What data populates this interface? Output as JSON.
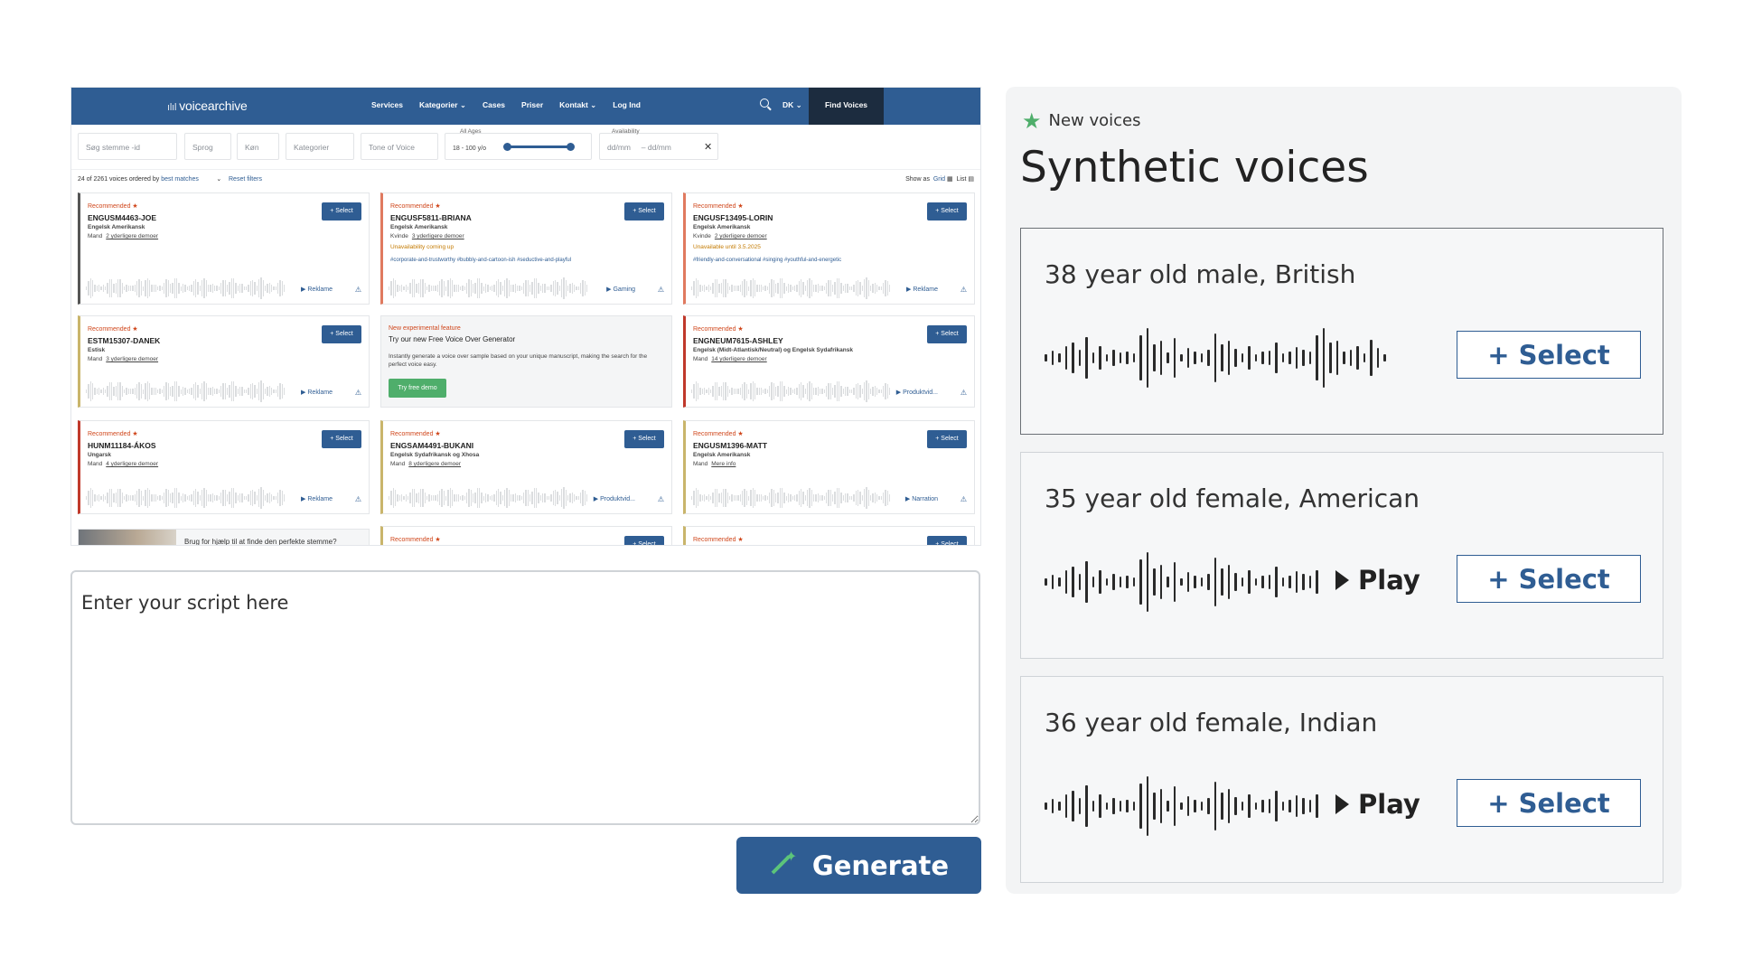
{
  "screenshot": {
    "logo": "voicearchive",
    "nav": [
      "Services",
      "Kategorier ⌄",
      "Cases",
      "Priser",
      "Kontakt ⌄",
      "Log Ind"
    ],
    "lang": "DK ⌄",
    "find_voices": "Find Voices",
    "filters": {
      "search_placeholder": "Søg stemme -id",
      "sprog": "Sprog",
      "kon": "Køn",
      "kategorier": "Kategorier",
      "tone": "Tone of Voice",
      "ages_label": "All Ages",
      "ages_range": "18 - 100 y/o",
      "availability_label": "Availability",
      "date_from": "dd/mm",
      "date_to": "– dd/mm",
      "clear": "✕"
    },
    "results": {
      "count": "24 of 2261 voices ordered by",
      "order": "best matches",
      "reset": "Reset filters",
      "show_as": "Show as",
      "grid": "Grid",
      "list": "List"
    },
    "cards": [
      {
        "rec": "Recommended",
        "id": "ENGUSM4463-JOE",
        "lang": "Engelsk Amerikansk",
        "gender": "Mand",
        "more": "2 yderligere demoer",
        "avail": "",
        "tags": "",
        "cat": "Reklame",
        "select": "+ Select"
      },
      {
        "rec": "Recommended",
        "id": "ENGUSF5811-BRIANA",
        "lang": "Engelsk Amerikansk",
        "gender": "Kvinde",
        "more": "3 yderligere demoer",
        "avail": "Unavailability coming up",
        "tags": "#corporate-and-trustworthy #bubbly-and-cartoon-ish #seductive-and-playful",
        "cat": "Gaming",
        "select": "+ Select"
      },
      {
        "rec": "Recommended",
        "id": "ENGUSF13495-LORIN",
        "lang": "Engelsk Amerikansk",
        "gender": "Kvinde",
        "more": "2 yderligere demoer",
        "avail": "Unavailable until 3.5.2025",
        "tags": "#friendly-and-conversational #singing #youthful-and-energetic",
        "cat": "Reklame",
        "select": "+ Select"
      },
      {
        "rec": "Recommended",
        "id": "ESTM15307-DANEK",
        "lang": "Estisk",
        "gender": "Mand",
        "more": "3 yderligere demoer",
        "avail": "",
        "tags": "",
        "cat": "Reklame",
        "select": "+ Select"
      },
      {
        "rec": "Recommended",
        "id": "ENGNEUM7615-ASHLEY",
        "lang": "Engelsk (Midt-Atlantisk/Neutral) og Engelsk Sydafrikansk",
        "gender": "Mand",
        "more": "14 yderligere demoer",
        "avail": "",
        "tags": "",
        "cat": "Produktvid...",
        "select": "+ Select"
      },
      {
        "rec": "Recommended",
        "id": "HUNM11184-ÁKOS",
        "lang": "Ungarsk",
        "gender": "Mand",
        "more": "4 yderligere demoer",
        "avail": "",
        "tags": "",
        "cat": "Reklame",
        "select": "+ Select"
      },
      {
        "rec": "Recommended",
        "id": "ENGSAM4491-BUKANI",
        "lang": "Engelsk Sydafrikansk og Xhosa",
        "gender": "Mand",
        "more": "8 yderligere demoer",
        "avail": "",
        "tags": "",
        "cat": "Produktvid...",
        "select": "+ Select"
      },
      {
        "rec": "Recommended",
        "id": "ENGUSM1396-MATT",
        "lang": "Engelsk Amerikansk",
        "gender": "Mand",
        "more": "Mere info",
        "avail": "",
        "tags": "",
        "cat": "Narration",
        "select": "+ Select"
      },
      {
        "rec": "Recommended",
        "id": "",
        "lang": "",
        "gender": "",
        "more": "",
        "avail": "",
        "tags": "",
        "cat": "",
        "select": "+ Select"
      },
      {
        "rec": "Recommended",
        "id": "",
        "lang": "",
        "gender": "",
        "more": "",
        "avail": "",
        "tags": "",
        "cat": "",
        "select": "+ Select"
      }
    ],
    "promo": {
      "label": "New experimental feature",
      "title": "Try our new Free Voice Over Generator",
      "body": "Instantly generate a voice over sample based on your unique manuscript, making the search for the perfect voice easy.",
      "button": "Try free demo"
    },
    "help": "Brug for hjælp til at finde den perfekte stemme?"
  },
  "script": {
    "placeholder": "Enter your script here"
  },
  "generate": {
    "label": "Generate",
    "icon": "magic-wand-icon"
  },
  "panel": {
    "badge": "New voices",
    "title": "Synthetic voices",
    "voices": [
      {
        "label": "38 year old male, British",
        "play": "",
        "select": "+ Select"
      },
      {
        "label": "35 year old female, American",
        "play": "Play",
        "select": "+ Select"
      },
      {
        "label": "36 year old female, Indian",
        "play": "Play",
        "select": "+ Select"
      }
    ]
  },
  "colors": {
    "accent": "#2f5d93",
    "green": "#4fae6b",
    "recommended": "#d0471c"
  }
}
